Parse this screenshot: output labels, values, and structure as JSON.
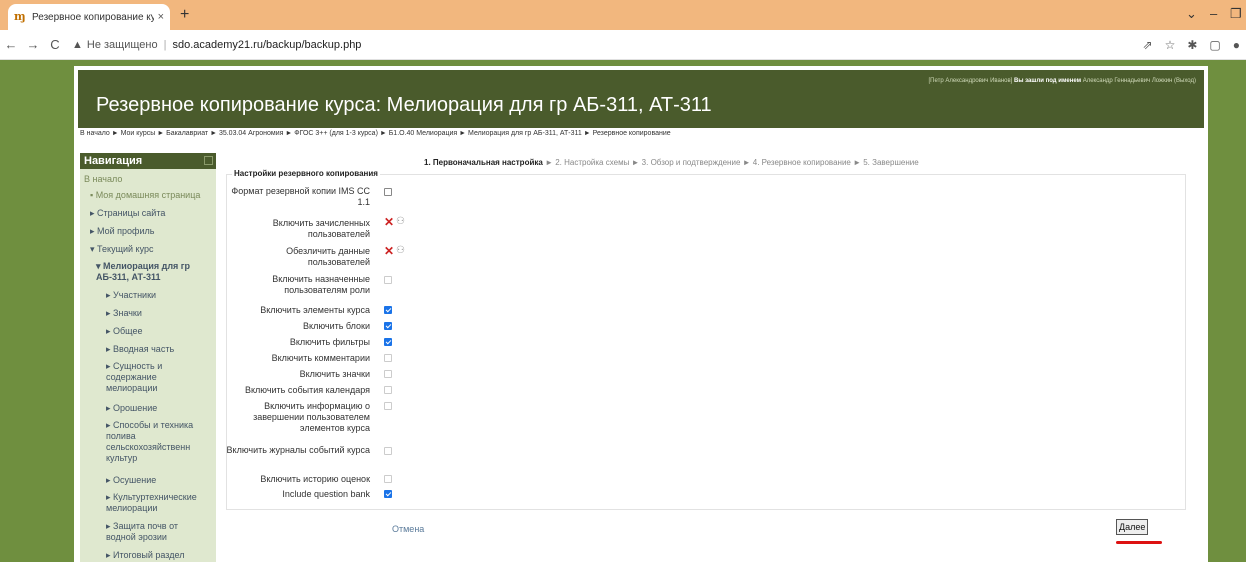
{
  "browser": {
    "tab_title": "Резервное копирование курса",
    "tab_close": "×",
    "new_tab": "+",
    "url_warning": "Не защищено",
    "url_separator": "|",
    "url": "sdo.academy21.ru/backup/backup.php",
    "nav": {
      "back": "←",
      "forward": "→",
      "reload": "C"
    },
    "addr_icons": [
      "⇗",
      "☆",
      "✱",
      "▢",
      "●"
    ],
    "window_controls": [
      "⌄",
      "–",
      "❐"
    ]
  },
  "header": {
    "login_user": "[Петр Александрович Иванов]",
    "login_as_label": "Вы зашли под именем",
    "login_as_user": "Александр Геннадьевич Ложкин",
    "logout": "(Выход)",
    "title": "Резервное копирование курса: Мелиорация для гр АБ-311, АТ-311"
  },
  "breadcrumb": "В начало ► Мои курсы ► Бакалавриат ► 35.03.04 Агрономия ► ФГОС 3++ (для 1-3 курса) ► Б1.О.40 Мелиорация ► Мелиорация для гр АБ-311, АТ-311 ► Резервное копирование",
  "navigation": {
    "title": "Навигация",
    "items": [
      {
        "label": "В начало"
      },
      {
        "label": "Моя домашняя страница"
      },
      {
        "label": "Страницы сайта"
      },
      {
        "label": "Мой профиль"
      },
      {
        "label": "Текущий курс"
      },
      {
        "label": "Мелиорация для гр АБ-311, АТ-311"
      },
      {
        "label": "Участники"
      },
      {
        "label": "Значки"
      },
      {
        "label": "Общее"
      },
      {
        "label": "Вводная часть"
      },
      {
        "label": "Сущность и содержание мелиорации"
      },
      {
        "label": "Орошение"
      },
      {
        "label": "Способы и техника полива сельскохозяйственн культур"
      },
      {
        "label": "Осушение"
      },
      {
        "label": "Культуртехнические мелиорации"
      },
      {
        "label": "Защита почв от водной эрозии"
      },
      {
        "label": "Итоговый раздел"
      }
    ]
  },
  "steps": {
    "current": "1. Первоначальная настройка",
    "rest": "► 2. Настройка схемы ► 3. Обзор и подтверждение ► 4. Резервное копирование ► 5. Завершение"
  },
  "settings": {
    "legend": "Настройки резервного копирования",
    "rows": [
      {
        "label": "Формат резервной копии IMS CC 1.1",
        "state": "unchecked"
      },
      {
        "label": "Включить зачисленных пользователей",
        "state": "locked"
      },
      {
        "label": "Обезличить данные пользователей",
        "state": "locked"
      },
      {
        "label": "Включить назначенные пользователям роли",
        "state": "disabled"
      },
      {
        "label": "Включить элементы курса",
        "state": "checked"
      },
      {
        "label": "Включить блоки",
        "state": "checked"
      },
      {
        "label": "Включить фильтры",
        "state": "checked"
      },
      {
        "label": "Включить комментарии",
        "state": "disabled"
      },
      {
        "label": "Включить значки",
        "state": "disabled"
      },
      {
        "label": "Включить события календаря",
        "state": "disabled"
      },
      {
        "label": "Включить информацию о завершении пользователем элементов курса",
        "state": "disabled"
      },
      {
        "label": "Включить журналы событий курса",
        "state": "disabled"
      },
      {
        "label": "Включить историю оценок",
        "state": "disabled"
      },
      {
        "label": "Include question bank",
        "state": "checked"
      }
    ]
  },
  "actions": {
    "cancel": "Отмена",
    "next": "Далее"
  },
  "colors": {
    "header_bg": "#4a5b2c",
    "page_bg": "#6f8f3f",
    "checkbox_checked": "#1a73e8",
    "locked_x": "#cc2222",
    "annotation_underline": "#dd1111"
  }
}
